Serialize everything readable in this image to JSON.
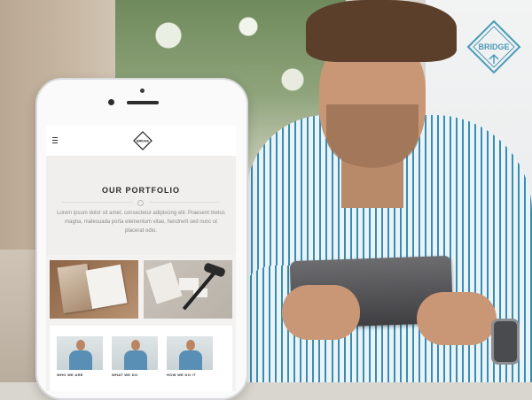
{
  "brand": {
    "name": "BRIDGE",
    "accent_color": "#4a9bb8"
  },
  "site": {
    "logo_text": "BRIDGE",
    "menu_icon": "hamburger-menu-icon"
  },
  "portfolio": {
    "title": "OUR PORTFOLIO",
    "description": "Lorem ipsum dolor sit amet, consectetur adipiscing elit. Praesent metus magna, malesuada porta elementum vitae, hendrerit sed nunc ut placerat odio."
  },
  "team": {
    "items": [
      {
        "label": "WHO WE ARE"
      },
      {
        "label": "WHAT WE DO"
      },
      {
        "label": "HOW WE DO IT"
      }
    ]
  }
}
